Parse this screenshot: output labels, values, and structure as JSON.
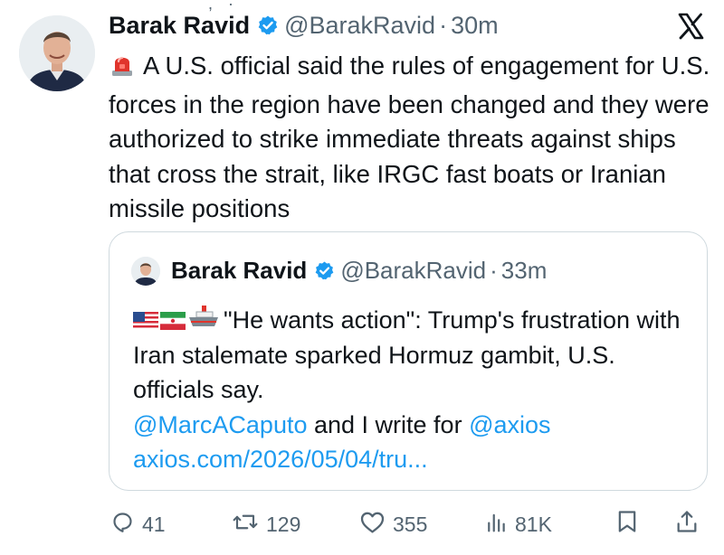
{
  "top_fragment": ", ·",
  "tweet": {
    "author_name": "Barak Ravid",
    "handle": "@BarakRavid",
    "separator": "·",
    "time": "30m",
    "text": "A U.S. official said the rules of engagement for U.S. forces in the region have been changed and they were authorized to strike immediate threats against ships that cross the strait, like IRGC fast boats or Iranian missile positions"
  },
  "quote": {
    "author_name": "Barak Ravid",
    "handle": "@BarakRavid",
    "separator": "·",
    "time": "33m",
    "text_main": "\"He wants action\": Trump's frustration with Iran stalemate sparked Hormuz gambit, U.S. officials say.",
    "mention1": "@MarcACaputo",
    "text_mid": " and I write for ",
    "mention2": "@axios",
    "link": "axios.com/2026/05/04/tru..."
  },
  "actions": {
    "replies": "41",
    "reposts": "129",
    "likes": "355",
    "views": "81K"
  },
  "icons": {
    "verified": "verified-badge-icon",
    "x_logo": "x-logo-icon",
    "siren": "police-light-icon",
    "reply": "reply-icon",
    "repost": "repost-icon",
    "like": "heart-icon",
    "views": "views-icon",
    "bookmark": "bookmark-icon",
    "share": "share-icon"
  },
  "colors": {
    "text": "#0f1419",
    "secondary": "#536471",
    "link": "#1d9bf0",
    "verified": "#1d9bf0",
    "border": "#cfd9de"
  }
}
